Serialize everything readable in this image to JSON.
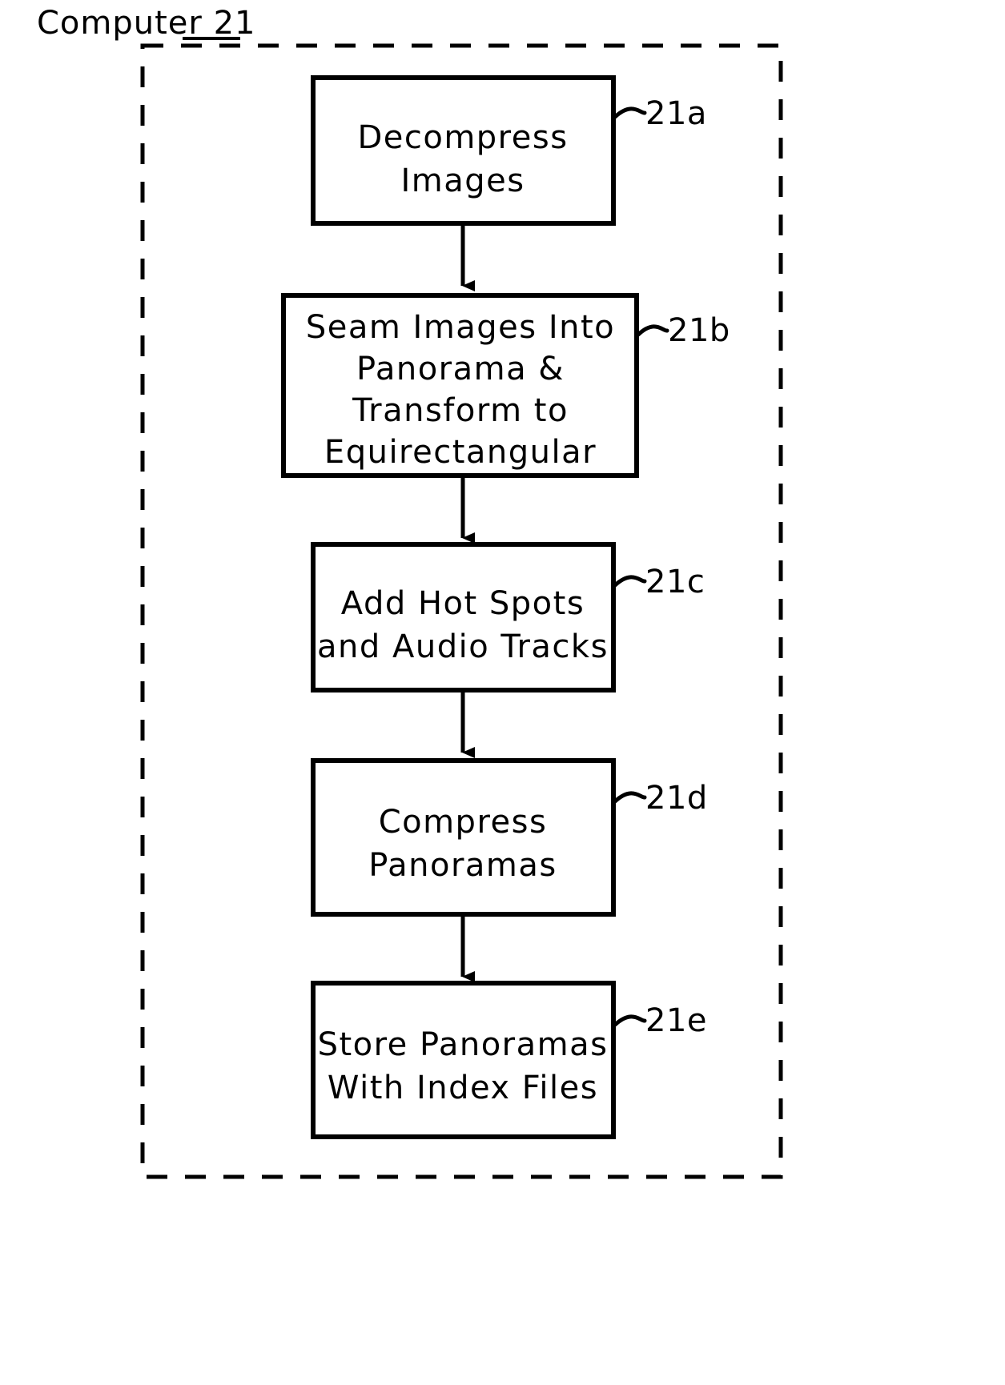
{
  "figure": {
    "title": "Computer 21",
    "boundary_label": "Computer 21",
    "boundary_style": "dashed"
  },
  "steps": [
    {
      "id": "21a",
      "ref": "21a",
      "lines": [
        "Decompress",
        "Images"
      ],
      "line1": "Decompress",
      "line2": "Images",
      "line3": "",
      "line4": ""
    },
    {
      "id": "21b",
      "ref": "21b",
      "lines": [
        "Seam Images Into",
        "Panorama &",
        "Transform to",
        "Equirectangular"
      ],
      "line1": "Seam Images Into",
      "line2": "Panorama &",
      "line3": "Transform to",
      "line4": "Equirectangular"
    },
    {
      "id": "21c",
      "ref": "21c",
      "lines": [
        "Add Hot Spots",
        "and Audio Tracks"
      ],
      "line1": "Add Hot Spots",
      "line2": "and Audio Tracks",
      "line3": "",
      "line4": ""
    },
    {
      "id": "21d",
      "ref": "21d",
      "lines": [
        "Compress",
        "Panoramas"
      ],
      "line1": "Compress",
      "line2": "Panoramas",
      "line3": "",
      "line4": ""
    },
    {
      "id": "21e",
      "ref": "21e",
      "lines": [
        "Store Panoramas",
        "With Index Files"
      ],
      "line1": "Store Panoramas",
      "line2": "With Index Files",
      "line3": "",
      "line4": ""
    }
  ],
  "connectors": [
    {
      "from": "21a",
      "to": "21b",
      "type": "arrow-down"
    },
    {
      "from": "21b",
      "to": "21c",
      "type": "arrow-down"
    },
    {
      "from": "21c",
      "to": "21d",
      "type": "arrow-down"
    },
    {
      "from": "21d",
      "to": "21e",
      "type": "arrow-down"
    }
  ],
  "colors": {
    "ink": "#000000",
    "paper": "#ffffff"
  }
}
